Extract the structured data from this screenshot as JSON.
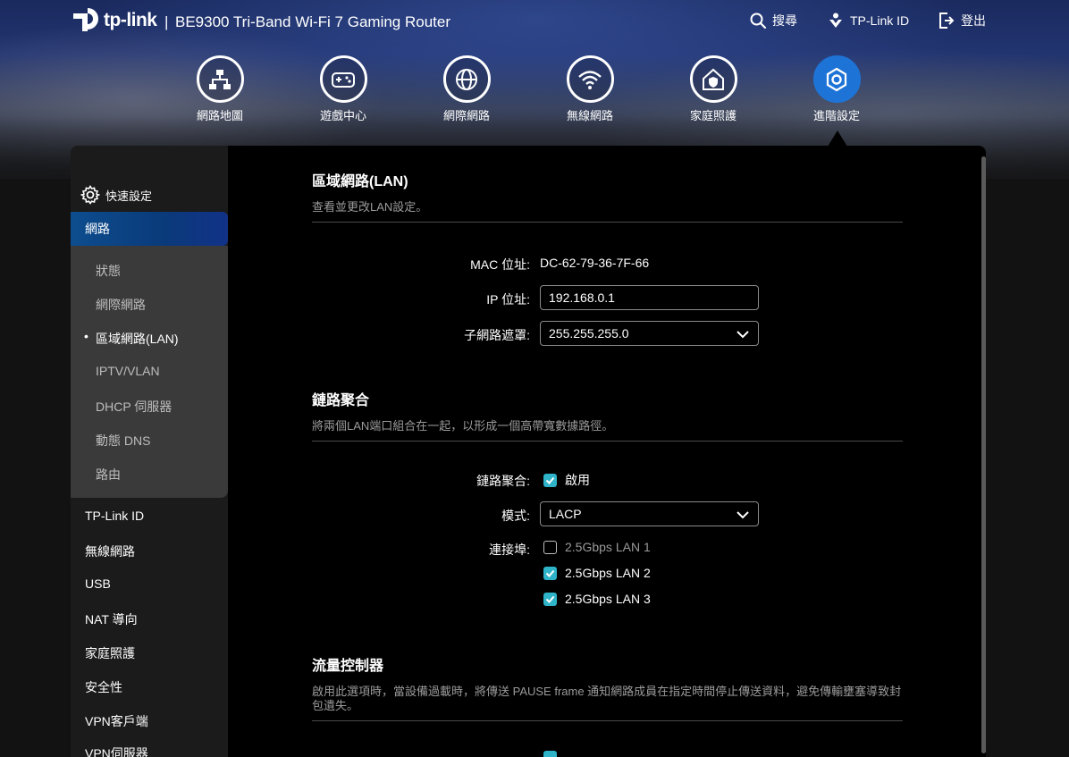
{
  "header": {
    "logo_text": "tp-link",
    "separator": "|",
    "product": "BE9300 Tri-Band Wi-Fi 7 Gaming Router",
    "search": "搜尋",
    "tplink_id": "TP-Link ID",
    "logout": "登出"
  },
  "nav": [
    {
      "label": "網路地圖",
      "icon": "network-map-icon"
    },
    {
      "label": "遊戲中心",
      "icon": "gamepad-icon"
    },
    {
      "label": "網際網路",
      "icon": "globe-icon"
    },
    {
      "label": "無線網路",
      "icon": "wifi-icon"
    },
    {
      "label": "家庭照護",
      "icon": "home-shield-icon"
    },
    {
      "label": "進階設定",
      "icon": "gear-icon",
      "active": true
    }
  ],
  "sidebar": {
    "quick_setup": "快速設定",
    "network": "網路",
    "network_sub": [
      "狀態",
      "網際網路",
      "區域網路(LAN)",
      "IPTV/VLAN",
      "DHCP 伺服器",
      "動態 DNS",
      "路由"
    ],
    "active_sub": "區域網路(LAN)",
    "items": [
      "TP-Link ID",
      "無線網路",
      "USB",
      "NAT 導向",
      "家庭照護",
      "安全性",
      "VPN客戶端",
      "VPN伺服器"
    ]
  },
  "lan": {
    "title": "區域網路(LAN)",
    "desc": "查看並更改LAN設定。",
    "mac_label": "MAC 位址:",
    "mac_value": "DC-62-79-36-7F-66",
    "ip_label": "IP 位址:",
    "ip_value": "192.168.0.1",
    "mask_label": "子網路遮罩:",
    "mask_value": "255.255.255.0"
  },
  "aggregation": {
    "title": "鏈路聚合",
    "desc": "將兩個LAN端口組合在一起，以形成一個高帶寬數據路徑。",
    "enable_label": "鏈路聚合:",
    "enable_text": "啟用",
    "enabled": true,
    "mode_label": "模式:",
    "mode_value": "LACP",
    "ports_label": "連接埠:",
    "ports": [
      {
        "name": "2.5Gbps LAN 1",
        "checked": false
      },
      {
        "name": "2.5Gbps LAN 2",
        "checked": true
      },
      {
        "name": "2.5Gbps LAN 3",
        "checked": true
      }
    ]
  },
  "flow": {
    "title": "流量控制器",
    "desc": "啟用此選項時，當設備過載時，將傳送 PAUSE frame 通知網路成員在指定時間停止傳送資料，避免傳輸壅塞導致封包遺失。"
  },
  "colors": {
    "accent": "#2fb3c9",
    "active_nav": "#1e74d6",
    "sidebar_active": "#0d4d8e"
  }
}
